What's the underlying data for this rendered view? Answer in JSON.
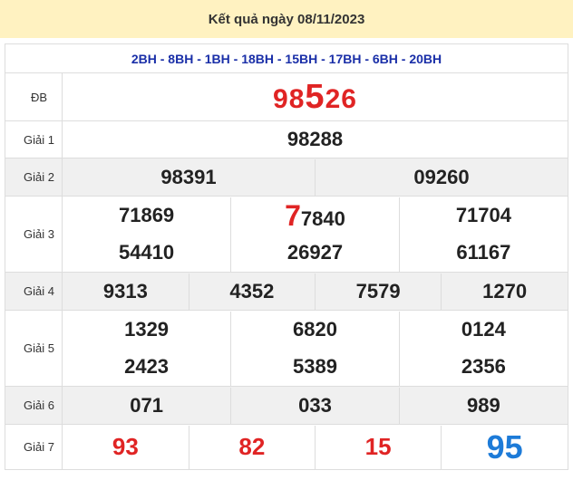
{
  "header": {
    "title": "Kết quả ngày 08/11/2023"
  },
  "codes": "2BH - 8BH - 1BH - 18BH - 15BH - 17BH - 6BH - 20BH",
  "special": {
    "label": "ĐB",
    "prefix": "98",
    "highlight": "5",
    "suffix": "26"
  },
  "prize1": {
    "label": "Giải 1",
    "values": [
      "98288"
    ]
  },
  "prize2": {
    "label": "Giải 2",
    "values": [
      "98391",
      "09260"
    ]
  },
  "prize3": {
    "label": "Giải 3",
    "first": {
      "highlight": "7",
      "rest": "7840"
    },
    "values": [
      "71869",
      "77840",
      "71704",
      "54410",
      "26927",
      "61167"
    ]
  },
  "prize4": {
    "label": "Giải 4",
    "values": [
      "9313",
      "4352",
      "7579",
      "1270"
    ]
  },
  "prize5": {
    "label": "Giải 5",
    "values": [
      "1329",
      "6820",
      "0124",
      "2423",
      "5389",
      "2356"
    ]
  },
  "prize6": {
    "label": "Giải 6",
    "values": [
      "071",
      "033",
      "989"
    ]
  },
  "prize7": {
    "label": "Giải 7",
    "values": [
      "93",
      "82",
      "15",
      "95"
    ]
  },
  "colors": {
    "header_bg": "#fff2c1",
    "codes": "#1a2fa8",
    "highlight_red": "#e02424",
    "highlight_blue": "#1d7bd8",
    "row_shade": "#f0f0f0"
  }
}
